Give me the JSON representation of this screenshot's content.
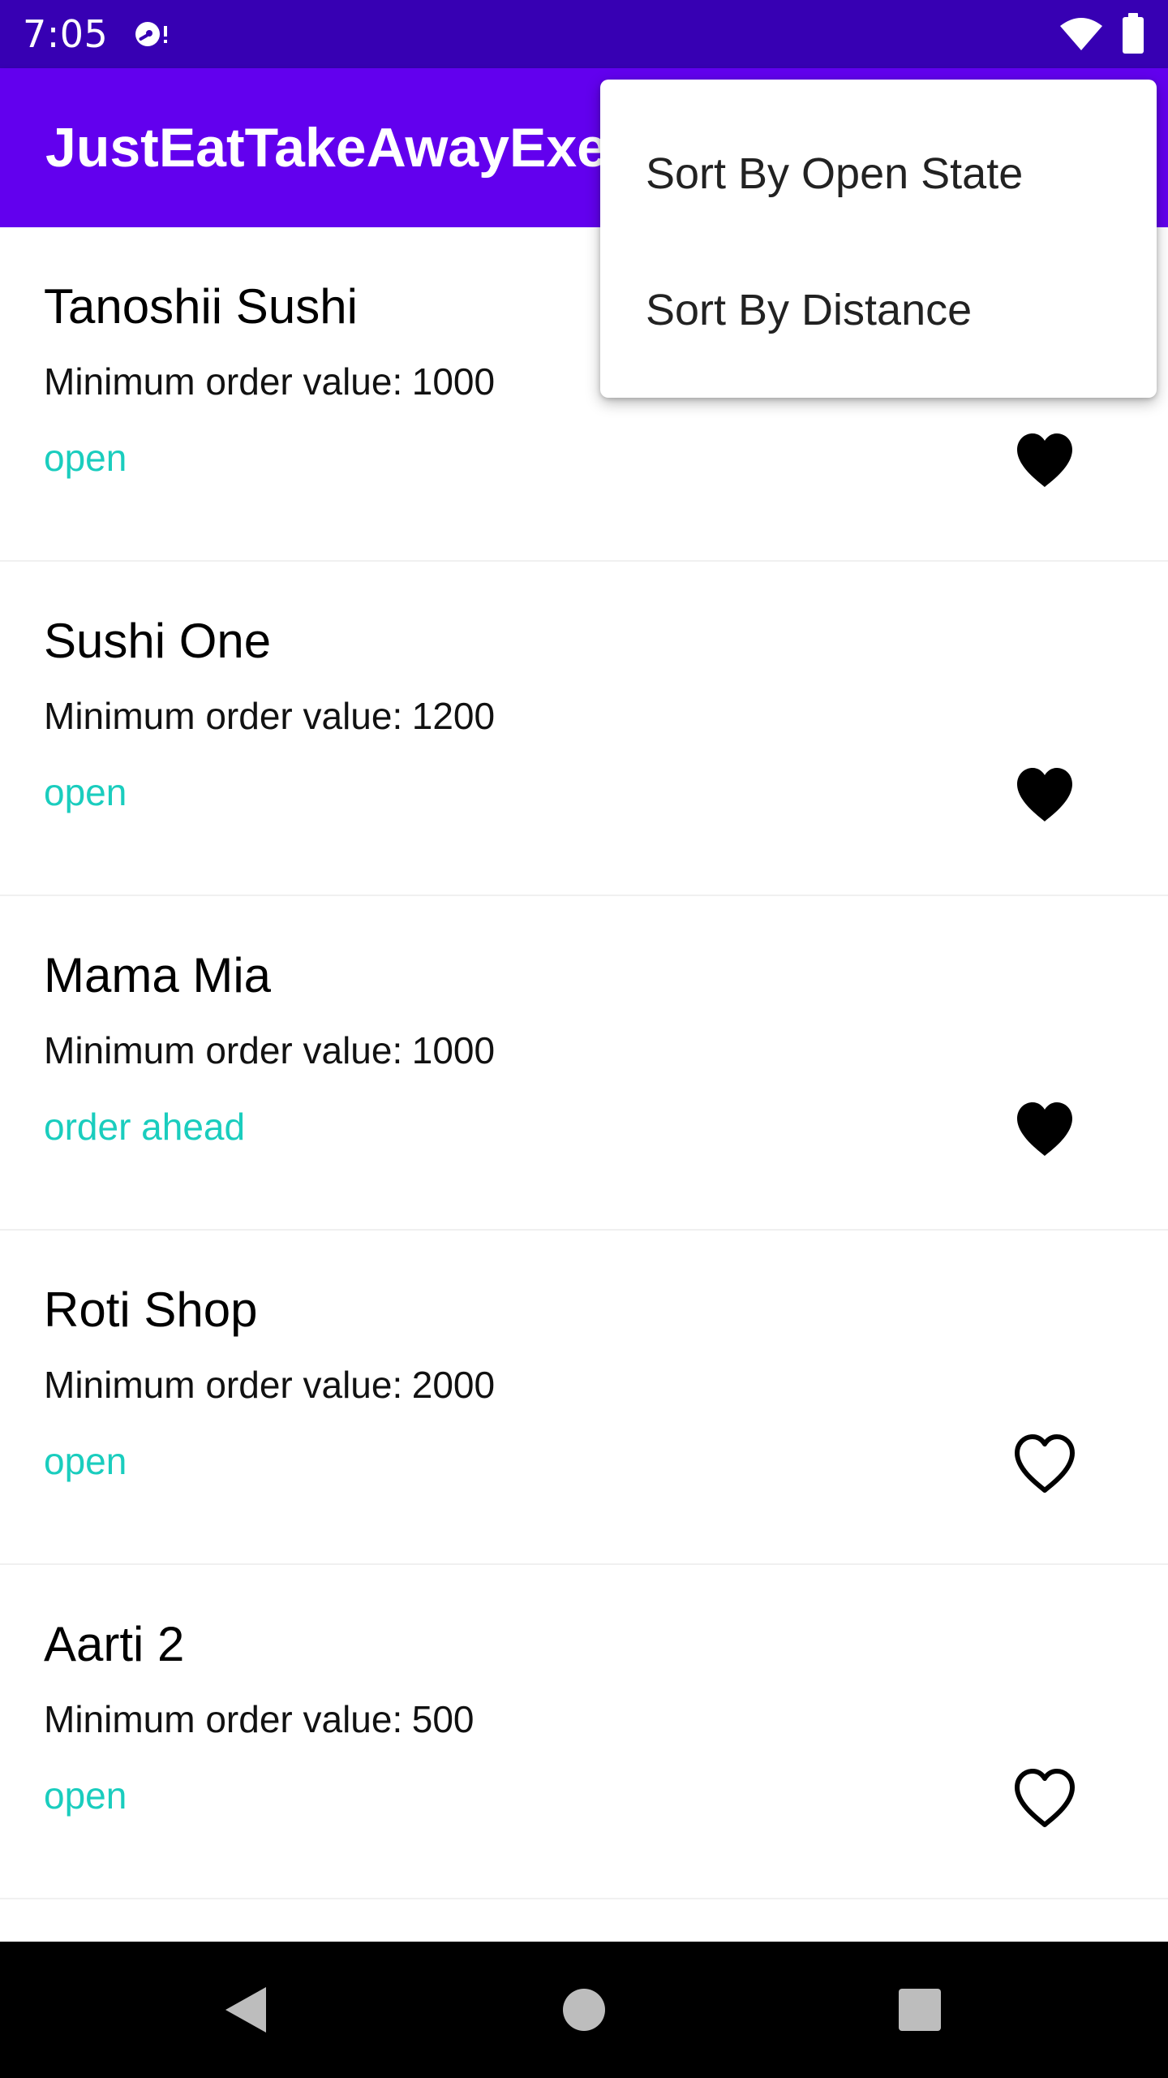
{
  "status_bar": {
    "time": "7:05",
    "icons": [
      "disc-alert-icon",
      "wifi-icon",
      "battery-icon"
    ]
  },
  "app_bar": {
    "title": "JustEatTakeAwayExe"
  },
  "menu": {
    "items": [
      {
        "label": "Sort By Open State"
      },
      {
        "label": "Sort By Distance"
      }
    ]
  },
  "restaurants": [
    {
      "name": "Tanoshii Sushi",
      "min_order_label": "Minimum order value:",
      "min_order_value": "1000",
      "status": "open",
      "favorite": true
    },
    {
      "name": "Sushi One",
      "min_order_label": "Minimum order value:",
      "min_order_value": "1200",
      "status": "open",
      "favorite": true
    },
    {
      "name": "Mama Mia",
      "min_order_label": "Minimum order value:",
      "min_order_value": "1000",
      "status": "order ahead",
      "favorite": true
    },
    {
      "name": "Roti Shop",
      "min_order_label": "Minimum order value:",
      "min_order_value": "2000",
      "status": "open",
      "favorite": false
    },
    {
      "name": "Aarti 2",
      "min_order_label": "Minimum order value:",
      "min_order_value": "500",
      "status": "open",
      "favorite": false
    }
  ],
  "nav_bar": {
    "icons": [
      "back-icon",
      "home-icon",
      "recents-icon"
    ]
  },
  "colors": {
    "status_bar": "#3700B3",
    "app_bar": "#6200EE",
    "status_text": "#1ACDBE",
    "nav_bar": "#000000"
  }
}
